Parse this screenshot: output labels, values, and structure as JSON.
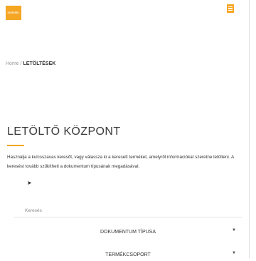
{
  "header": {
    "logo_text": "SCHIEDEL",
    "menu_icon": "hamburger-icon"
  },
  "breadcrumb": {
    "home": "Home",
    "separator": " / ",
    "current": "LETÖLTÉSEK"
  },
  "page": {
    "title": "LETÖLTŐ KÖZPONT",
    "description": "Használja a kulcsszavas keresőt, vagy válassza ki a keresett terméket, amelyről információkat szeretne letölteni. A keresést tovább szűkítheti a dokumentum típusának megadásával."
  },
  "search": {
    "placeholder": "Keresés"
  },
  "filters": {
    "document_type": "DOKUMENTUM TÍPUSA",
    "product_group": "TERMÉKCSOPORT"
  },
  "colors": {
    "accent": "#F5A623"
  }
}
